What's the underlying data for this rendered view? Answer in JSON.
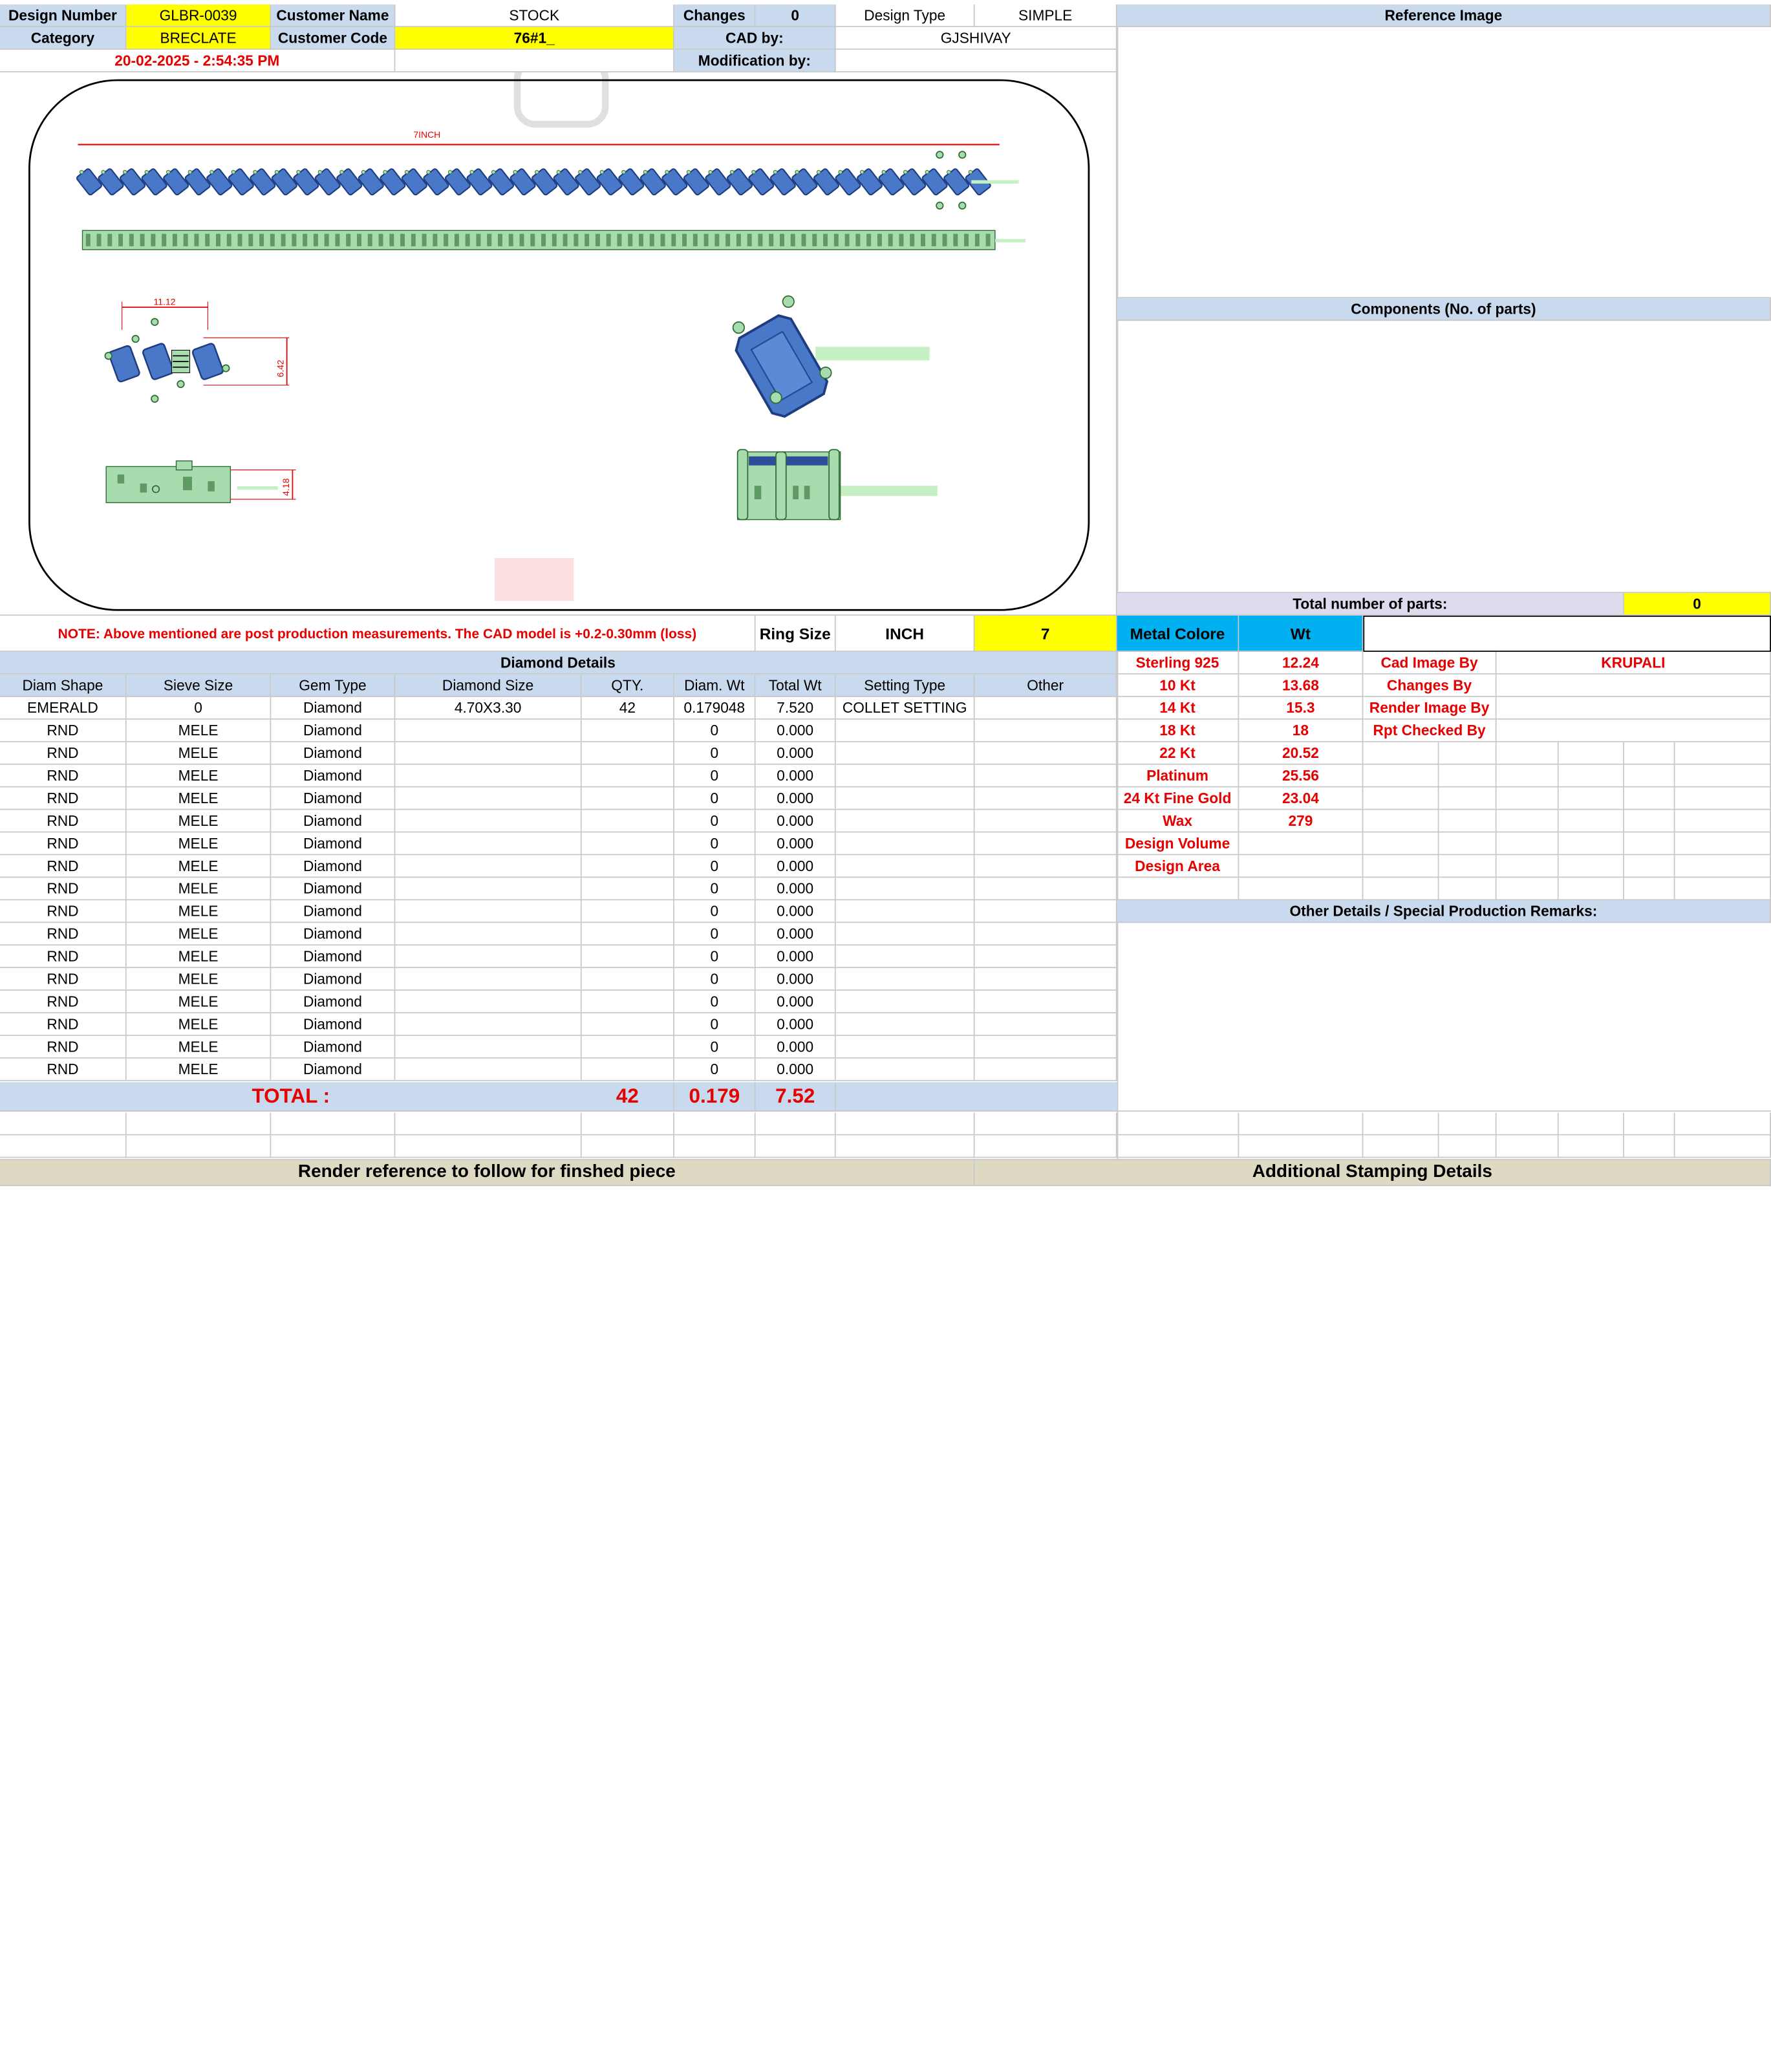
{
  "header": {
    "design_number_label": "Design Number",
    "design_number": "GLBR-0039",
    "customer_name_label": "Customer Name",
    "customer_name": "STOCK",
    "changes_label": "Changes",
    "changes": "0",
    "design_type_label": "Design Type",
    "design_type": "SIMPLE",
    "category_label": "Category",
    "category": "BRECLATE",
    "customer_code_label": "Customer Code",
    "customer_code": "76#1_",
    "cad_by_label": "CAD by:",
    "cad_by": "GJSHIVAY",
    "datetime": "20-02-2025 - 2:54:35 PM",
    "modification_by_label": "Modification by:"
  },
  "drawing": {
    "length_label": "7INCH",
    "dim_width": "11.12",
    "dim_height": "6.42",
    "dim_side": "4.18"
  },
  "right_panel": {
    "reference_image_title": "Reference Image",
    "components_title": "Components (No. of parts)",
    "total_parts_label": "Total number of parts:",
    "total_parts": "0"
  },
  "note": {
    "text": "NOTE: Above mentioned are post production measurements. The CAD model is +0.2-0.30mm (loss)",
    "ring_size_label": "Ring Size",
    "ring_size_unit": "INCH",
    "ring_size_value": "7"
  },
  "diamond": {
    "title": "Diamond Details",
    "headers": [
      "Diam Shape",
      "Sieve Size",
      "Gem Type",
      "Diamond Size",
      "QTY.",
      "Diam. Wt",
      "Total Wt",
      "Setting Type",
      "Other"
    ],
    "rows": [
      [
        "EMERALD",
        "0",
        "Diamond",
        "4.70X3.30",
        "42",
        "0.179048",
        "7.520",
        "COLLET SETTING",
        ""
      ],
      [
        "RND",
        "MELE",
        "Diamond",
        "",
        "",
        "0",
        "0.000",
        "",
        ""
      ],
      [
        "RND",
        "MELE",
        "Diamond",
        "",
        "",
        "0",
        "0.000",
        "",
        ""
      ],
      [
        "RND",
        "MELE",
        "Diamond",
        "",
        "",
        "0",
        "0.000",
        "",
        ""
      ],
      [
        "RND",
        "MELE",
        "Diamond",
        "",
        "",
        "0",
        "0.000",
        "",
        ""
      ],
      [
        "RND",
        "MELE",
        "Diamond",
        "",
        "",
        "0",
        "0.000",
        "",
        ""
      ],
      [
        "RND",
        "MELE",
        "Diamond",
        "",
        "",
        "0",
        "0.000",
        "",
        ""
      ],
      [
        "RND",
        "MELE",
        "Diamond",
        "",
        "",
        "0",
        "0.000",
        "",
        ""
      ],
      [
        "RND",
        "MELE",
        "Diamond",
        "",
        "",
        "0",
        "0.000",
        "",
        ""
      ],
      [
        "RND",
        "MELE",
        "Diamond",
        "",
        "",
        "0",
        "0.000",
        "",
        ""
      ],
      [
        "RND",
        "MELE",
        "Diamond",
        "",
        "",
        "0",
        "0.000",
        "",
        ""
      ],
      [
        "RND",
        "MELE",
        "Diamond",
        "",
        "",
        "0",
        "0.000",
        "",
        ""
      ],
      [
        "RND",
        "MELE",
        "Diamond",
        "",
        "",
        "0",
        "0.000",
        "",
        ""
      ],
      [
        "RND",
        "MELE",
        "Diamond",
        "",
        "",
        "0",
        "0.000",
        "",
        ""
      ],
      [
        "RND",
        "MELE",
        "Diamond",
        "",
        "",
        "0",
        "0.000",
        "",
        ""
      ],
      [
        "RND",
        "MELE",
        "Diamond",
        "",
        "",
        "0",
        "0.000",
        "",
        ""
      ],
      [
        "RND",
        "MELE",
        "Diamond",
        "",
        "",
        "0",
        "0.000",
        "",
        ""
      ]
    ],
    "total_label": "TOTAL :",
    "total_qty": "42",
    "total_diam_wt": "0.179",
    "total_wt": "7.52"
  },
  "metal": {
    "col1": "Metal Colore",
    "col2": "Wt",
    "rows": [
      [
        "Sterling 925",
        "12.24"
      ],
      [
        "10 Kt",
        "13.68"
      ],
      [
        "14 Kt",
        "15.3"
      ],
      [
        "18 Kt",
        "18"
      ],
      [
        "22 Kt",
        "20.52"
      ],
      [
        "Platinum",
        "25.56"
      ],
      [
        "24 Kt Fine Gold",
        "23.04"
      ],
      [
        "Wax",
        "279"
      ],
      [
        "Design Volume",
        ""
      ],
      [
        "Design Area",
        ""
      ]
    ]
  },
  "credits": {
    "rows": [
      [
        "Cad Image By",
        "KRUPALI"
      ],
      [
        "Changes By",
        ""
      ],
      [
        "Render Image By",
        ""
      ],
      [
        "Rpt Checked By",
        ""
      ]
    ]
  },
  "remarks_title": "Other Details / Special Production Remarks:",
  "footer": {
    "render_reference": "Render reference to follow for finshed piece",
    "stamping": "Additional Stamping Details"
  },
  "colors": {
    "yellow": "#ffff00",
    "header_blue": "#c9d9ee",
    "cyan": "#00b0f0",
    "red": "#e60000",
    "stone_blue": "#4a78c8",
    "metal_green": "#a8dcae"
  }
}
